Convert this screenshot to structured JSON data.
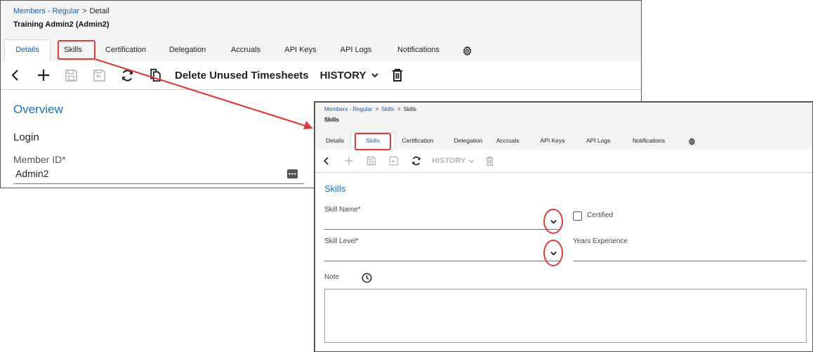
{
  "back": {
    "breadcrumb": [
      "Members - Regular",
      "Detail"
    ],
    "subtitle": "Training Admin2 (Admin2)",
    "tabs": [
      "Details",
      "Skills",
      "Certification",
      "Delegation",
      "Accruals",
      "API Keys",
      "API Logs",
      "Notifications"
    ],
    "active_tab": "Details",
    "toolbar": {
      "delete_unused": "Delete Unused Timesheets",
      "history": "HISTORY"
    },
    "section_title": "Overview",
    "group_title": "Login",
    "member_id_label": "Member ID*",
    "member_id_value": "Admin2"
  },
  "front": {
    "breadcrumb": [
      "Members - Regular",
      "Skills",
      "Skills"
    ],
    "subtitle": "Skills",
    "tabs": [
      "Details",
      "Skills",
      "Certification",
      "Delegation",
      "Accruals",
      "API Keys",
      "API Logs",
      "Notifications"
    ],
    "active_tab": "Skills",
    "toolbar": {
      "history": "HISTORY"
    },
    "section_title": "Skills",
    "skill_name_label": "Skill Name*",
    "certified_label": "Certified",
    "skill_level_label": "Skill Level*",
    "years_experience_label": "Years Experience",
    "note_label": "Note"
  },
  "icons": {
    "back": "chevron-left-icon",
    "add": "plus-icon",
    "save": "save-icon",
    "save_close": "save-close-icon",
    "refresh": "refresh-icon",
    "copy": "copy-icon",
    "delete": "trash-icon",
    "settings": "gear-icon",
    "dropdown": "chevron-down-icon",
    "history": "clock-icon",
    "more": "more-icon"
  },
  "colors": {
    "accent": "#1a5ea8",
    "section_title": "#1f6fbf",
    "highlight": "#e03a3a",
    "disabled": "#b5b5b5"
  }
}
